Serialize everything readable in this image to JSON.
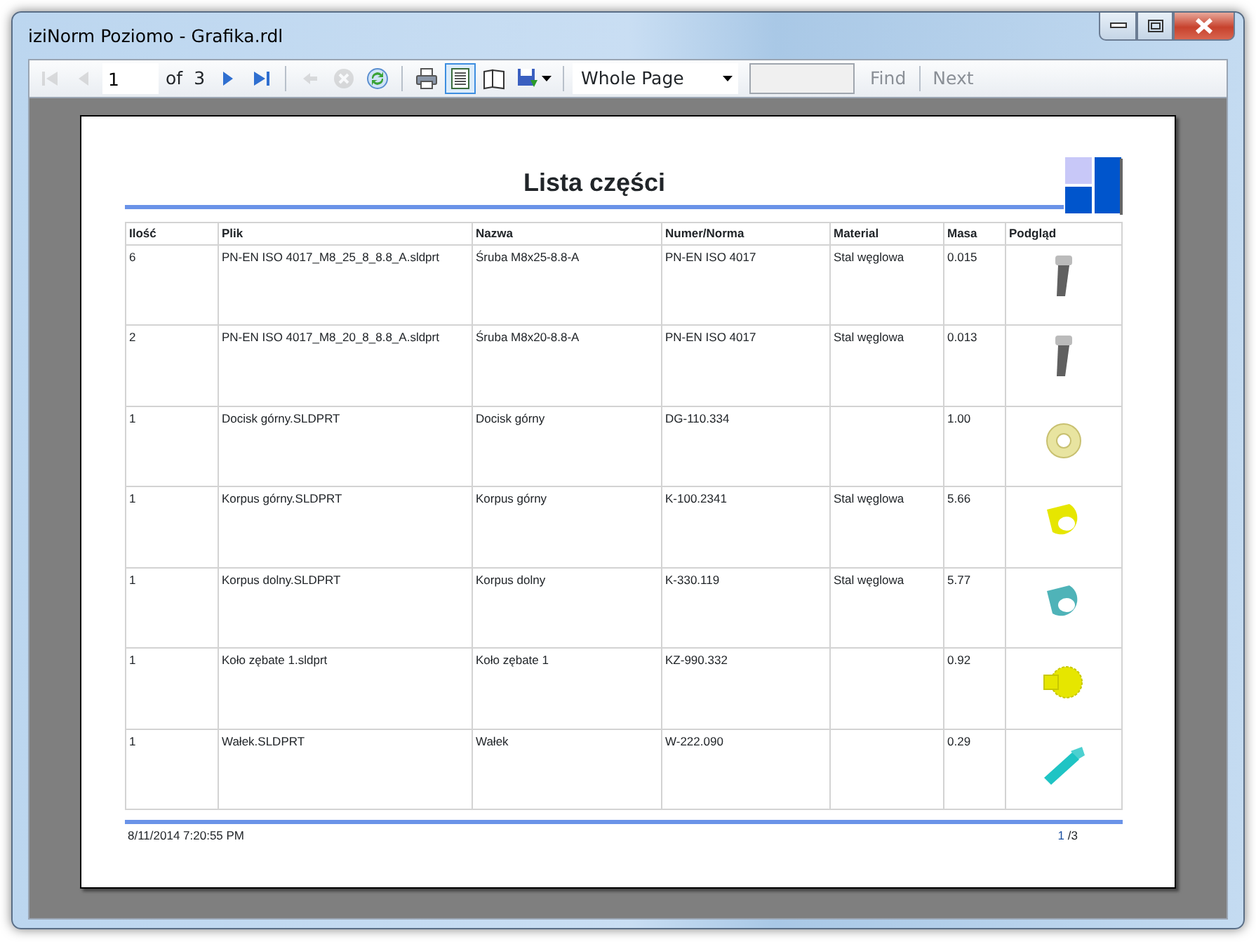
{
  "window": {
    "title": "iziNorm Poziomo - Grafika.rdl"
  },
  "toolbar": {
    "buttons": [
      {
        "kind": "first",
        "disabled": true
      },
      {
        "kind": "prev",
        "disabled": true
      },
      {
        "kind": "page_input",
        "value": "1"
      },
      {
        "kind": "of_label",
        "text": "of"
      },
      {
        "kind": "page_count",
        "text": "3"
      },
      {
        "kind": "next",
        "disabled": false
      },
      {
        "kind": "last",
        "disabled": false
      },
      {
        "kind": "sep"
      },
      {
        "kind": "back",
        "disabled": true
      },
      {
        "kind": "stop",
        "disabled": true
      },
      {
        "kind": "refresh",
        "disabled": false
      },
      {
        "kind": "sep"
      },
      {
        "kind": "print",
        "disabled": false
      },
      {
        "kind": "layout",
        "disabled": false,
        "selected": true
      },
      {
        "kind": "page_setup",
        "disabled": false,
        "selected": false
      },
      {
        "kind": "export",
        "disabled": false
      },
      {
        "kind": "sep"
      },
      {
        "kind": "zoom",
        "value": "Whole Page"
      },
      {
        "kind": "search"
      },
      {
        "kind": "find",
        "text": "Find",
        "disabled": true
      },
      {
        "kind": "sep"
      },
      {
        "kind": "find_next",
        "text": "Next",
        "disabled": true
      }
    ]
  },
  "report": {
    "title": "Lista części",
    "columns": [
      "Ilość",
      "Plik",
      "Nazwa",
      "Numer/Norma",
      "Material",
      "Masa",
      "Podgląd"
    ],
    "rows": [
      {
        "cells": [
          "6",
          "PN-EN ISO 4017_M8_25_8_8.8_A.sldprt",
          "Śruba M8x25-8.8-A",
          "PN-EN ISO 4017",
          "Stal węglowa",
          "0.015"
        ],
        "preview": {
          "kind": "bolt",
          "color": "#606060"
        }
      },
      {
        "cells": [
          "2",
          "PN-EN ISO 4017_M8_20_8_8.8_A.sldprt",
          "Śruba M8x20-8.8-A",
          "PN-EN ISO 4017",
          "Stal węglowa",
          "0.013"
        ],
        "preview": {
          "kind": "bolt",
          "color": "#606060"
        }
      },
      {
        "cells": [
          "1",
          "Docisk górny.SLDPRT",
          "Docisk górny",
          "DG-110.334",
          "",
          "1.00"
        ],
        "preview": {
          "kind": "disc",
          "color": "#e8e4a0"
        }
      },
      {
        "cells": [
          "1",
          "Korpus górny.SLDPRT",
          "Korpus górny",
          "K-100.2341",
          "Stal węglowa",
          "5.66"
        ],
        "preview": {
          "kind": "ring",
          "color": "#e6e600"
        }
      },
      {
        "cells": [
          "1",
          "Korpus dolny.SLDPRT",
          "Korpus dolny",
          "K-330.119",
          "Stal węglowa",
          "5.77"
        ],
        "preview": {
          "kind": "ring",
          "color": "#4fb3b8"
        }
      },
      {
        "cells": [
          "1",
          "Koło zębate 1.sldprt",
          "Koło zębate 1",
          "KZ-990.332",
          "",
          "0.92"
        ],
        "preview": {
          "kind": "gear",
          "color": "#e6e600"
        }
      },
      {
        "cells": [
          "1",
          "Wałek.SLDPRT",
          "Wałek",
          "W-222.090",
          "",
          "0.29"
        ],
        "preview": {
          "kind": "shaft",
          "color": "#1fc4c4"
        }
      }
    ],
    "footer": {
      "timestamp": "8/11/2014 7:20:55 PM",
      "page_number": "1",
      "page_total": "/3"
    }
  }
}
